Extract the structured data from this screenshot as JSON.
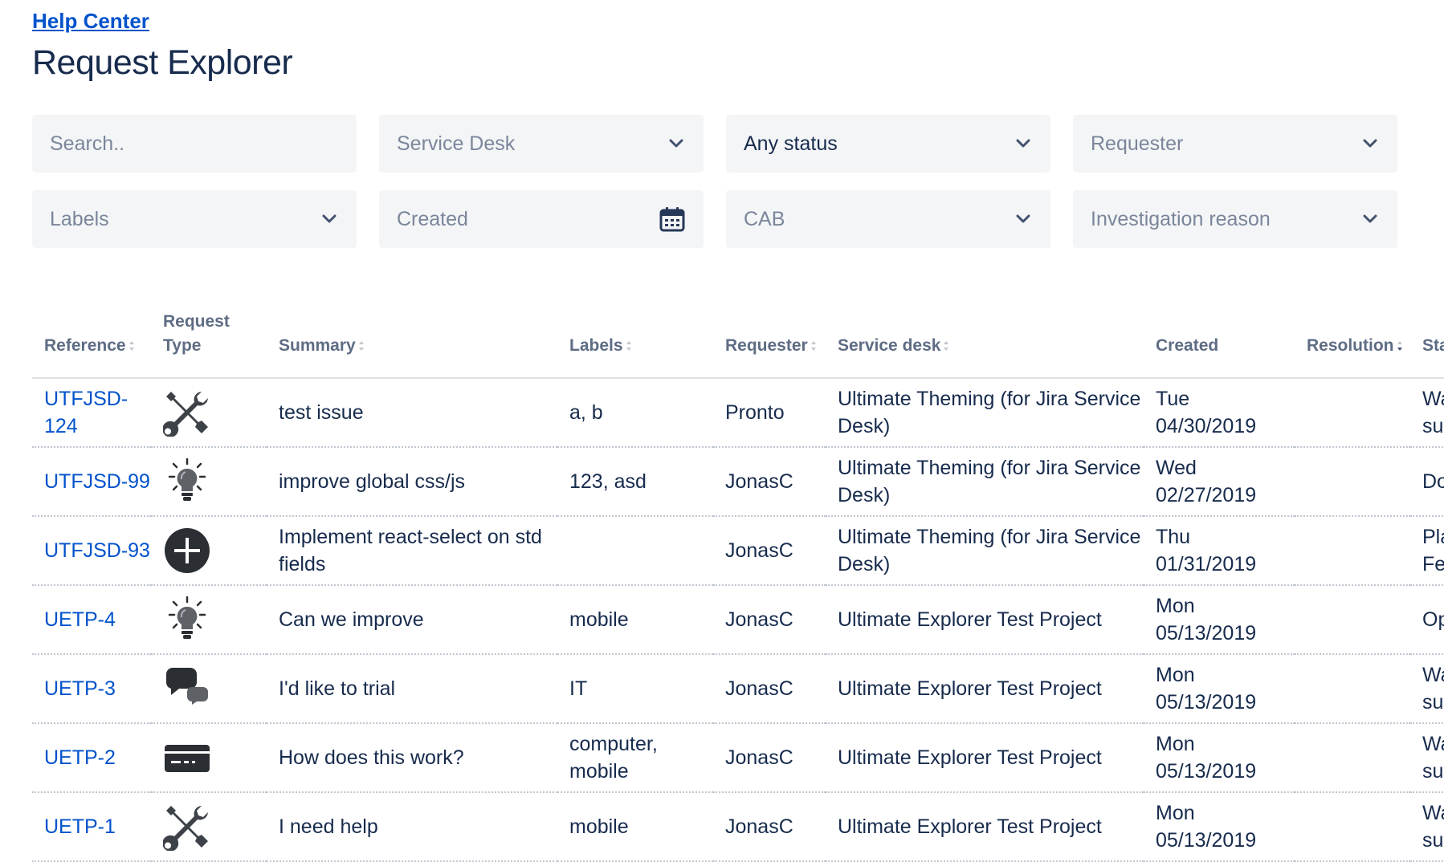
{
  "breadcrumb": "Help Center",
  "title": "Request Explorer",
  "filters": {
    "search_placeholder": "Search..",
    "service_desk": "Service Desk",
    "status": "Any status",
    "requester": "Requester",
    "labels": "Labels",
    "created": "Created",
    "cab": "CAB",
    "investigation_reason": "Investigation reason"
  },
  "columns": {
    "reference": "Reference",
    "request_type": "Request Type",
    "summary": "Summary",
    "labels": "Labels",
    "requester": "Requester",
    "service_desk": "Service desk",
    "created": "Created",
    "resolution": "Resolution",
    "status": "Sta"
  },
  "rows": [
    {
      "ref": "UTFJSD-124",
      "type_icon": "tools-icon",
      "summary": "test issue",
      "labels": "a, b",
      "requester": "Pronto",
      "service_desk": "Ultimate Theming (for Jira Service Desk)",
      "created_day": "Tue",
      "created_date": "04/30/2019",
      "resolution": "",
      "status_1": "Wa",
      "status_2": "su"
    },
    {
      "ref": "UTFJSD-99",
      "type_icon": "lightbulb-icon",
      "summary": "improve global css/js",
      "labels": "123, asd",
      "requester": "JonasC",
      "service_desk": "Ultimate Theming (for Jira Service Desk)",
      "created_day": "Wed",
      "created_date": "02/27/2019",
      "resolution": "",
      "status_1": "Do",
      "status_2": ""
    },
    {
      "ref": "UTFJSD-93",
      "type_icon": "plus-circle-icon",
      "summary": "Implement react-select on std fields",
      "labels": "",
      "requester": "JonasC",
      "service_desk": "Ultimate Theming (for Jira Service Desk)",
      "created_day": "Thu",
      "created_date": "01/31/2019",
      "resolution": "",
      "status_1": "Pla",
      "status_2": "Fe"
    },
    {
      "ref": "UETP-4",
      "type_icon": "lightbulb-icon",
      "summary": "Can we improve",
      "labels": "mobile",
      "requester": "JonasC",
      "service_desk": "Ultimate Explorer Test Project",
      "created_day": "Mon",
      "created_date": "05/13/2019",
      "resolution": "",
      "status_1": "Op",
      "status_2": ""
    },
    {
      "ref": "UETP-3",
      "type_icon": "chat-bubbles-icon",
      "summary": "I'd like to trial",
      "labels": "IT",
      "requester": "JonasC",
      "service_desk": "Ultimate Explorer Test Project",
      "created_day": "Mon",
      "created_date": "05/13/2019",
      "resolution": "",
      "status_1": "Wa",
      "status_2": "su"
    },
    {
      "ref": "UETP-2",
      "type_icon": "credit-card-icon",
      "summary": "How does this work?",
      "labels": "computer, mobile",
      "requester": "JonasC",
      "service_desk": "Ultimate Explorer Test Project",
      "created_day": "Mon",
      "created_date": "05/13/2019",
      "resolution": "",
      "status_1": "Wa",
      "status_2": "su"
    },
    {
      "ref": "UETP-1",
      "type_icon": "tools-icon",
      "summary": "I need help",
      "labels": "mobile",
      "requester": "JonasC",
      "service_desk": "Ultimate Explorer Test Project",
      "created_day": "Mon",
      "created_date": "05/13/2019",
      "resolution": "",
      "status_1": "Wa",
      "status_2": "su"
    }
  ]
}
